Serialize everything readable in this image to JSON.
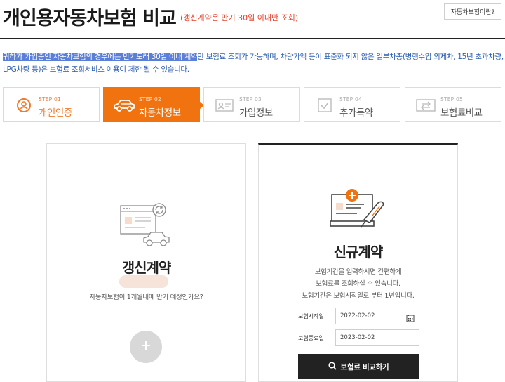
{
  "header": {
    "title": "개인용자동차보험 비교",
    "subtitle": "(갱신계약은 만기 30일 이내만 조회)",
    "help_button": "자동차보험이란?"
  },
  "notice": {
    "highlighted": "귀하가 가입중인 자동차보험의 경우에는 만기도래 30일 이내 계약",
    "rest": "만 보험료 조회가 가능하며, 차량가액 등이 표준화 되지 않은 일부차종(병행수입 외제차, 15년 초과차량, LPG차량 등)은 보험료 조회서비스 이용이 제한 될 수 있습니다."
  },
  "steps": [
    {
      "num": "STEP 01",
      "label": "개인인증",
      "state": "done",
      "icon": "user-search-icon"
    },
    {
      "num": "STEP 02",
      "label": "자동차정보",
      "state": "active",
      "icon": "car-icon"
    },
    {
      "num": "STEP 03",
      "label": "가입정보",
      "state": "pending",
      "icon": "id-card-icon"
    },
    {
      "num": "STEP 04",
      "label": "추가특약",
      "state": "pending",
      "icon": "checkbox-icon"
    },
    {
      "num": "STEP 05",
      "label": "보험료비교",
      "state": "pending",
      "icon": "compare-arrows-icon"
    }
  ],
  "renew_card": {
    "title": "갱신계약",
    "description": "자동차보험이 1개월내에 만기 예정인가요?",
    "icon": "renew-car-icon",
    "add_icon": "plus-icon"
  },
  "new_card": {
    "title": "신규계약",
    "desc_line1": "보험기간을 입력하시면 간편하게",
    "desc_line2": "보험료를 조회하실 수 있습니다.",
    "desc_line3": "보험기간은 보험시작일로 부터 1년입니다.",
    "start_label": "보험시작일",
    "start_value": "2022-02-02",
    "end_label": "보험종료일",
    "end_value": "2023-02-02",
    "compare_button": "보험료 비교하기",
    "icon": "new-contract-icon"
  },
  "colors": {
    "accent": "#f0730f",
    "notice_text": "#2a5db0",
    "subtitle_red": "#e8412c",
    "dark": "#222222"
  }
}
